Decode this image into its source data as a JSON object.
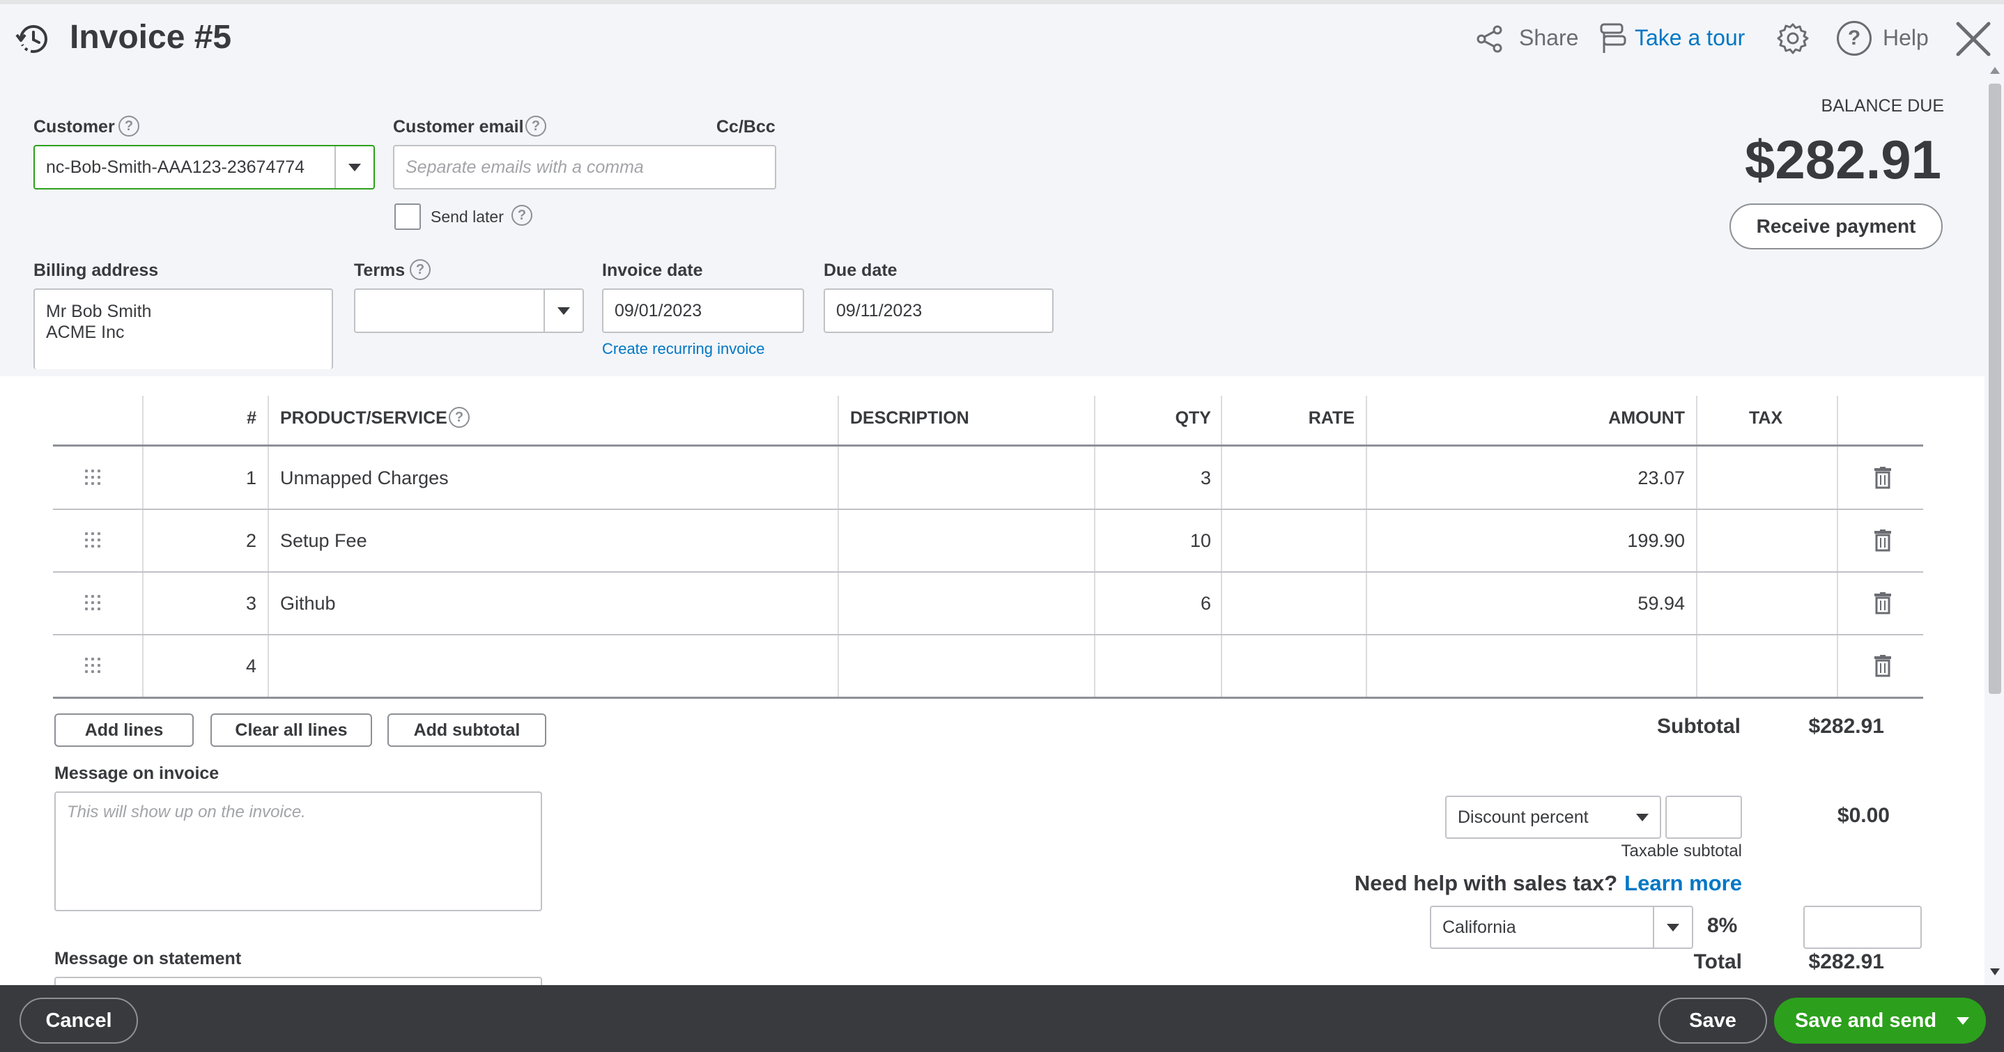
{
  "header": {
    "title": "Invoice #5",
    "share_label": "Share",
    "tour_label": "Take a tour",
    "help_label": "Help"
  },
  "customer": {
    "label": "Customer",
    "value": "nc-Bob-Smith-AAA123-23674774"
  },
  "email": {
    "label": "Customer email",
    "placeholder": "Separate emails with a comma",
    "cc_label": "Cc/Bcc",
    "send_later_label": "Send later"
  },
  "balance": {
    "label": "BALANCE DUE",
    "amount": "$282.91",
    "receive_label": "Receive payment"
  },
  "billing": {
    "label": "Billing address",
    "line1": "Mr Bob Smith",
    "line2": "ACME Inc"
  },
  "terms": {
    "label": "Terms",
    "value": ""
  },
  "invoice_date": {
    "label": "Invoice date",
    "value": "09/01/2023",
    "recurring_label": "Create recurring invoice"
  },
  "due_date": {
    "label": "Due date",
    "value": "09/11/2023"
  },
  "table": {
    "headers": {
      "num": "#",
      "product": "PRODUCT/SERVICE",
      "description": "DESCRIPTION",
      "qty": "QTY",
      "rate": "RATE",
      "amount": "AMOUNT",
      "tax": "TAX"
    },
    "rows": [
      {
        "num": "1",
        "product": "Unmapped Charges",
        "description": "",
        "qty": "3",
        "rate": "",
        "amount": "23.07"
      },
      {
        "num": "2",
        "product": "Setup Fee",
        "description": "",
        "qty": "10",
        "rate": "",
        "amount": "199.90"
      },
      {
        "num": "3",
        "product": "Github",
        "description": "",
        "qty": "6",
        "rate": "",
        "amount": "59.94"
      },
      {
        "num": "4",
        "product": "",
        "description": "",
        "qty": "",
        "rate": "",
        "amount": ""
      }
    ]
  },
  "actions": {
    "add_lines": "Add lines",
    "clear_lines": "Clear all lines",
    "add_subtotal": "Add subtotal"
  },
  "message_invoice": {
    "label": "Message on invoice",
    "placeholder": "This will show up on the invoice."
  },
  "message_statement": {
    "label": "Message on statement"
  },
  "totals": {
    "subtotal_label": "Subtotal",
    "subtotal_value": "$282.91",
    "discount_type": "Discount percent",
    "discount_value": "$0.00",
    "taxable_label": "Taxable subtotal",
    "sales_tax_help": "Need help with sales tax?",
    "learn_more": "Learn more",
    "tax_region": "California",
    "tax_rate": "8%",
    "total_label": "Total",
    "total_value": "$282.91"
  },
  "footer": {
    "cancel_label": "Cancel",
    "save_label": "Save",
    "save_send_label": "Save and send"
  },
  "colors": {
    "accent": "#0077c5",
    "primary_green": "#2ca01c",
    "footer_bg": "#393a3d",
    "form_bg": "#f4f5f8"
  }
}
